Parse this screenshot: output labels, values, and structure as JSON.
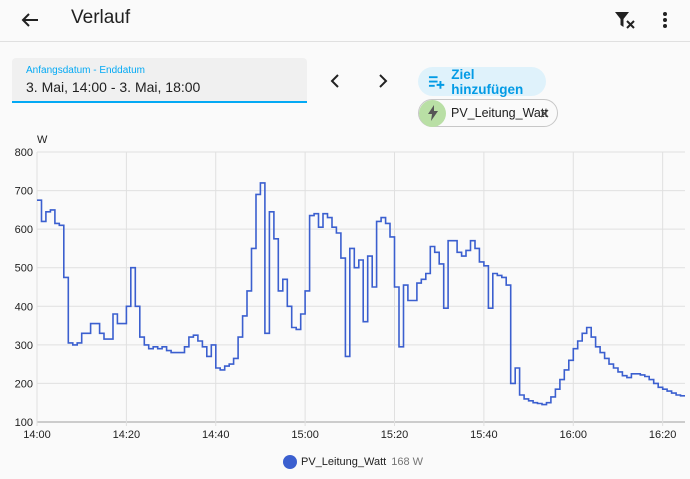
{
  "header": {
    "title": "Verlauf"
  },
  "date_range": {
    "label": "Anfangsdatum - Enddatum",
    "value": "3. Mai, 14:00 - 3. Mai, 18:00"
  },
  "add_target": {
    "label": "Ziel hinzufügen"
  },
  "entity_chip": {
    "label": "PV_Leitung_Watt"
  },
  "colors": {
    "accent": "#03a9f4",
    "series": "#3b5fcf",
    "chip_avatar": "#b9dfa5"
  },
  "legend": {
    "name": "PV_Leitung_Watt",
    "value": "168 W"
  },
  "chart_data": {
    "type": "line",
    "step": true,
    "ylabel": "W",
    "ylim": [
      100,
      800
    ],
    "yticks": [
      100,
      200,
      300,
      400,
      500,
      600,
      700,
      800
    ],
    "xlim_minutes": [
      0,
      145
    ],
    "xticks": [
      "14:00",
      "14:20",
      "14:40",
      "15:00",
      "15:20",
      "15:40",
      "16:00",
      "16:20"
    ],
    "grid": true,
    "series": [
      {
        "name": "PV_Leitung_Watt",
        "x_minutes": [
          0,
          1,
          2,
          3,
          4,
          5,
          6,
          7,
          8,
          9,
          10,
          11,
          12,
          13,
          14,
          15,
          16,
          17,
          18,
          19,
          20,
          21,
          22,
          23,
          24,
          25,
          26,
          27,
          28,
          29,
          30,
          31,
          32,
          33,
          34,
          35,
          36,
          37,
          38,
          39,
          40,
          41,
          42,
          43,
          44,
          45,
          46,
          47,
          48,
          49,
          50,
          51,
          52,
          53,
          54,
          55,
          56,
          57,
          58,
          59,
          60,
          61,
          62,
          63,
          64,
          65,
          66,
          67,
          68,
          69,
          70,
          71,
          72,
          73,
          74,
          75,
          76,
          77,
          78,
          79,
          80,
          81,
          82,
          83,
          84,
          85,
          86,
          87,
          88,
          89,
          90,
          91,
          92,
          93,
          94,
          95,
          96,
          97,
          98,
          99,
          100,
          101,
          102,
          103,
          104,
          105,
          106,
          107,
          108,
          109,
          110,
          111,
          112,
          113,
          114,
          115,
          116,
          117,
          118,
          119,
          120,
          121,
          122,
          123,
          124,
          125,
          126,
          127,
          128,
          129,
          130,
          131,
          132,
          133,
          134,
          135,
          136,
          137,
          138,
          139,
          140,
          141,
          142,
          143,
          144,
          145
        ],
        "values": [
          675,
          620,
          645,
          650,
          615,
          610,
          475,
          305,
          300,
          305,
          330,
          330,
          355,
          355,
          330,
          315,
          315,
          380,
          355,
          355,
          400,
          500,
          400,
          320,
          300,
          290,
          295,
          290,
          295,
          285,
          280,
          280,
          280,
          295,
          320,
          325,
          310,
          295,
          270,
          300,
          240,
          235,
          245,
          250,
          265,
          320,
          375,
          440,
          550,
          690,
          720,
          330,
          645,
          575,
          440,
          470,
          400,
          345,
          340,
          380,
          440,
          635,
          640,
          605,
          640,
          630,
          605,
          590,
          525,
          270,
          550,
          500,
          520,
          360,
          530,
          450,
          620,
          630,
          615,
          580,
          450,
          295,
          455,
          415,
          415,
          460,
          470,
          485,
          555,
          540,
          510,
          395,
          570,
          570,
          540,
          530,
          545,
          570,
          550,
          515,
          505,
          395,
          485,
          480,
          475,
          455,
          200,
          240,
          170,
          160,
          155,
          150,
          148,
          145,
          150,
          165,
          185,
          210,
          235,
          260,
          290,
          310,
          330,
          345,
          320,
          295,
          280,
          265,
          250,
          240,
          230,
          220,
          215,
          225,
          225,
          222,
          218,
          210,
          200,
          190,
          185,
          180,
          175,
          170,
          168,
          168
        ]
      }
    ]
  }
}
